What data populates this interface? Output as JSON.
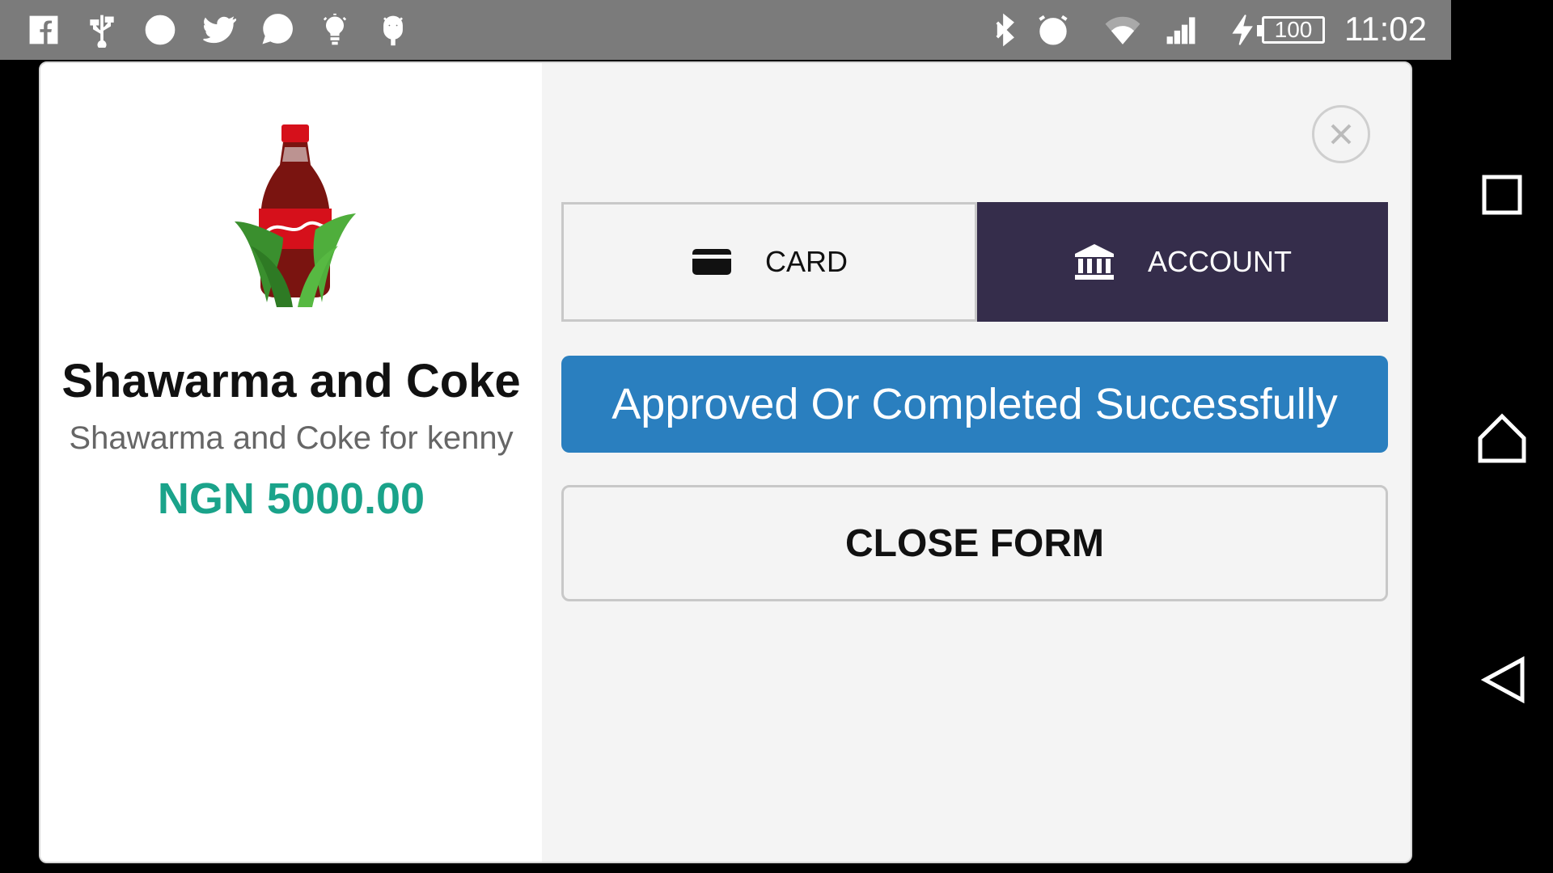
{
  "status_bar": {
    "icons": [
      "facebook-icon",
      "usb-icon",
      "opera-icon",
      "twitter-icon",
      "whatsapp-icon",
      "lightbulb-icon",
      "android-icon",
      "bluetooth-icon",
      "alarm-icon",
      "wifi-icon",
      "signal-icon",
      "charging-icon"
    ],
    "battery": "100",
    "time": "11:02"
  },
  "product": {
    "image_icon": "coke-bottle-icon",
    "title": "Shawarma and Coke",
    "description": "Shawarma and Coke for kenny",
    "price": "NGN 5000.00"
  },
  "payment": {
    "tabs": [
      {
        "label": "CARD",
        "icon": "credit-card-icon",
        "selected": false
      },
      {
        "label": "ACCOUNT",
        "icon": "bank-icon",
        "selected": true
      }
    ],
    "status_message": "Approved Or Completed Successfully",
    "close_form_label": "CLOSE FORM"
  },
  "colors": {
    "status_bar": "#7b7b7b",
    "tab_selected": "#352d4b",
    "success_banner": "#2a7fbf",
    "price": "#1aa38a"
  }
}
